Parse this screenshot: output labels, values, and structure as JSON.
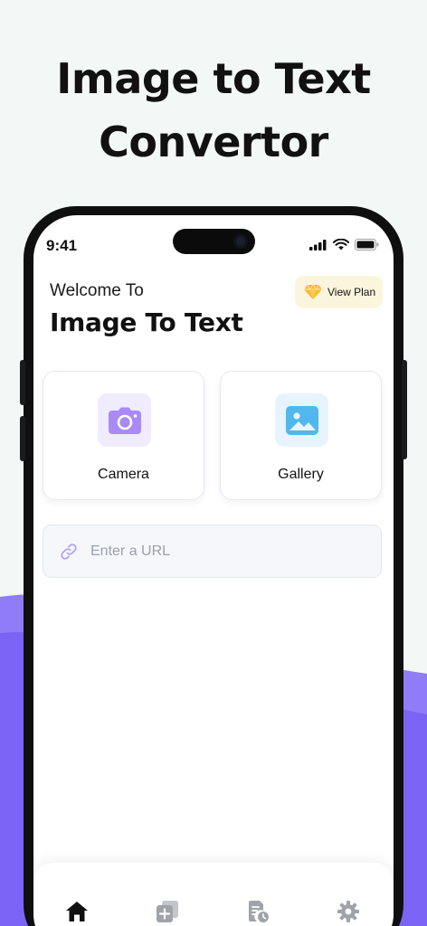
{
  "promo": {
    "title_line1": "Image to Text",
    "title_line2": "Convertor"
  },
  "status_bar": {
    "time": "9:41",
    "icons": [
      "signal-icon",
      "wifi-icon",
      "battery-icon"
    ]
  },
  "header": {
    "welcome": "Welcome To",
    "title": "Image To Text",
    "plan_button": {
      "label": "View Plan",
      "icon": "diamond-icon"
    }
  },
  "sources": [
    {
      "label": "Camera",
      "icon": "camera-icon"
    },
    {
      "label": "Gallery",
      "icon": "image-icon"
    }
  ],
  "url_input": {
    "placeholder": "Enter a URL",
    "value": "",
    "icon": "link-icon"
  },
  "tabbar": {
    "tabs": [
      {
        "name": "home",
        "icon": "home-icon",
        "active": true
      },
      {
        "name": "add",
        "icon": "add-document-icon",
        "active": false
      },
      {
        "name": "history",
        "icon": "document-history-icon",
        "active": false
      },
      {
        "name": "settings",
        "icon": "gear-icon",
        "active": false
      }
    ]
  },
  "colors": {
    "accent_purple": "#7b5cf5",
    "active_tab": "#111111",
    "inactive_tab": "#a1a3ab",
    "plan_bg": "#fcf5dd",
    "page_bg": "#f3f7f6"
  }
}
